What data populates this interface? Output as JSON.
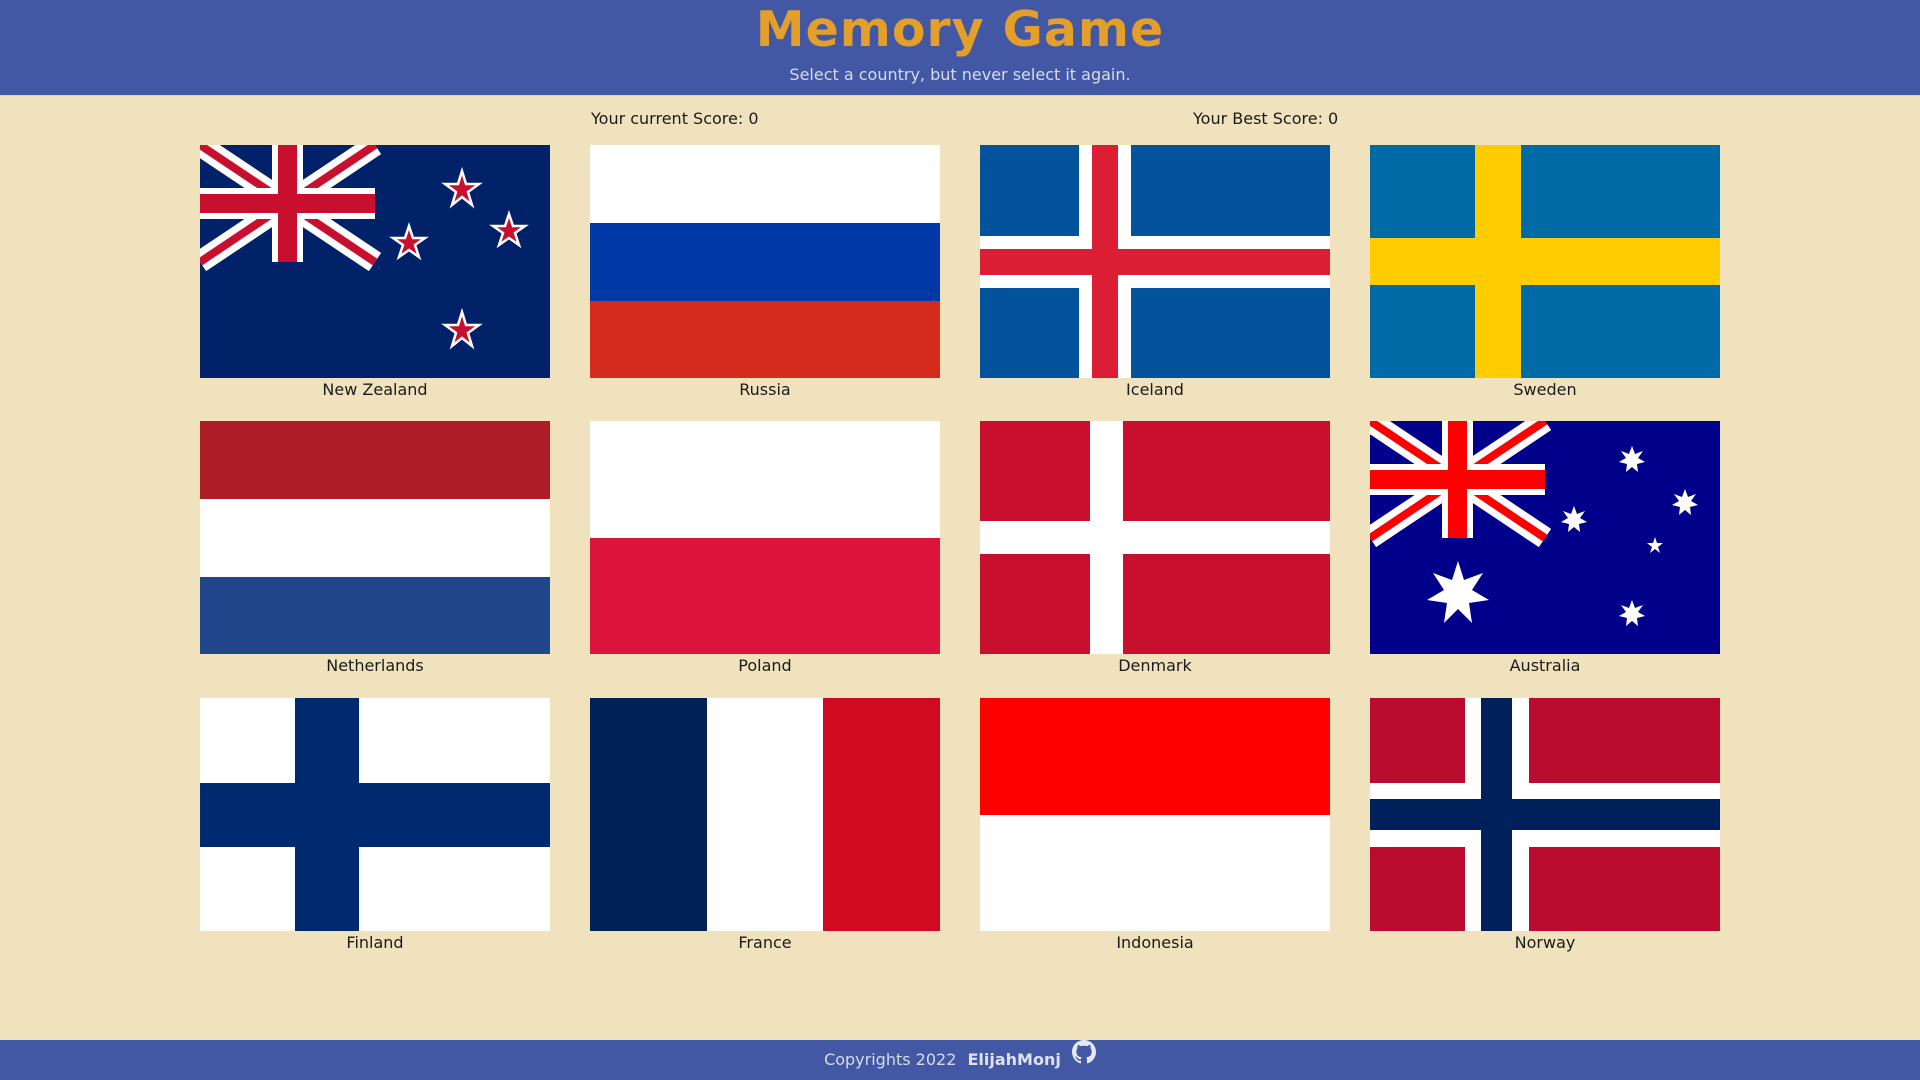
{
  "header": {
    "title": "Memory Game",
    "subtitle": "Select a country, but never select it again."
  },
  "scores": {
    "current_label": "Your current Score: 0",
    "best_label": "Your Best Score: 0"
  },
  "cards": [
    {
      "name": "New Zealand",
      "flag": "new-zealand"
    },
    {
      "name": "Russia",
      "flag": "russia"
    },
    {
      "name": "Iceland",
      "flag": "iceland"
    },
    {
      "name": "Sweden",
      "flag": "sweden"
    },
    {
      "name": "Netherlands",
      "flag": "netherlands"
    },
    {
      "name": "Poland",
      "flag": "poland"
    },
    {
      "name": "Denmark",
      "flag": "denmark"
    },
    {
      "name": "Australia",
      "flag": "australia"
    },
    {
      "name": "Finland",
      "flag": "finland"
    },
    {
      "name": "France",
      "flag": "france"
    },
    {
      "name": "Indonesia",
      "flag": "indonesia"
    },
    {
      "name": "Norway",
      "flag": "norway"
    }
  ],
  "footer": {
    "copyright": "Copyrights 2022",
    "author": "ElijahMonj",
    "icon": "github-icon"
  },
  "colors": {
    "header_bg": "#4358a5",
    "title": "#e39f2a",
    "page_bg": "#f0e2bd"
  }
}
